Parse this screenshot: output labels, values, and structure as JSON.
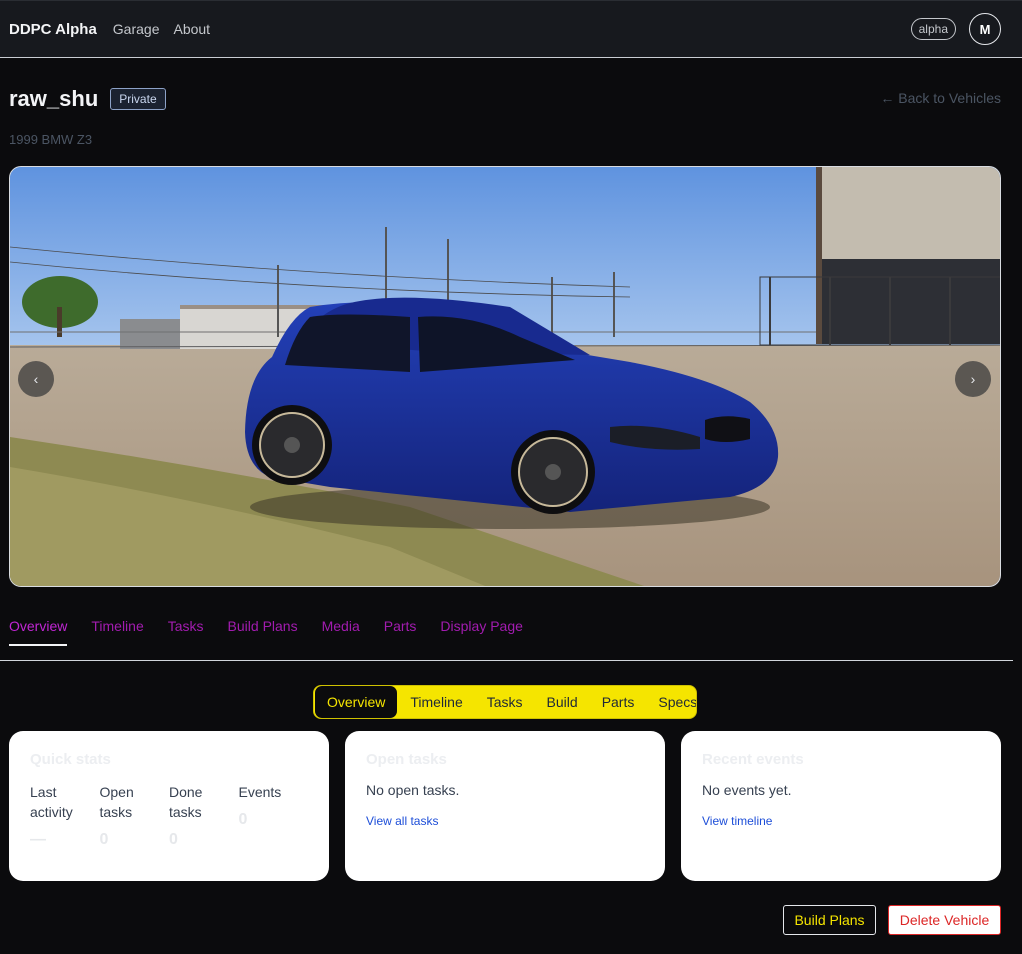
{
  "navbar": {
    "brand": "DDPC Alpha",
    "links": [
      "Garage",
      "About"
    ],
    "env_badge": "alpha",
    "avatar_initial": "M"
  },
  "vehicle": {
    "name": "raw_shu",
    "visibility": "Private",
    "description": "1999 BMW Z3",
    "back_link": "← Back to Vehicles"
  },
  "carousel": {
    "prev": "‹",
    "next": "›"
  },
  "main_tabs": [
    "Overview",
    "Timeline",
    "Tasks",
    "Build Plans",
    "Media",
    "Parts",
    "Display Page"
  ],
  "sub_tabs": [
    "Overview",
    "Timeline",
    "Tasks",
    "Build",
    "Parts",
    "Specs"
  ],
  "quick_stats": {
    "title": "Quick stats",
    "items": [
      {
        "label": "Last activity",
        "value": "—"
      },
      {
        "label": "Open tasks",
        "value": "0"
      },
      {
        "label": "Done tasks",
        "value": "0"
      },
      {
        "label": "Events",
        "value": "0"
      }
    ]
  },
  "open_tasks": {
    "title": "Open tasks",
    "empty": "No open tasks.",
    "link": "View all tasks"
  },
  "recent_events": {
    "title": "Recent events",
    "empty": "No events yet.",
    "link": "View timeline"
  },
  "actions": {
    "build_plans": "Build Plans",
    "delete": "Delete Vehicle"
  },
  "colors": {
    "accent_tab": "#a21caf",
    "segmented_bg": "#f5e500",
    "danger": "#dc2626",
    "link": "#1d4ed8"
  }
}
